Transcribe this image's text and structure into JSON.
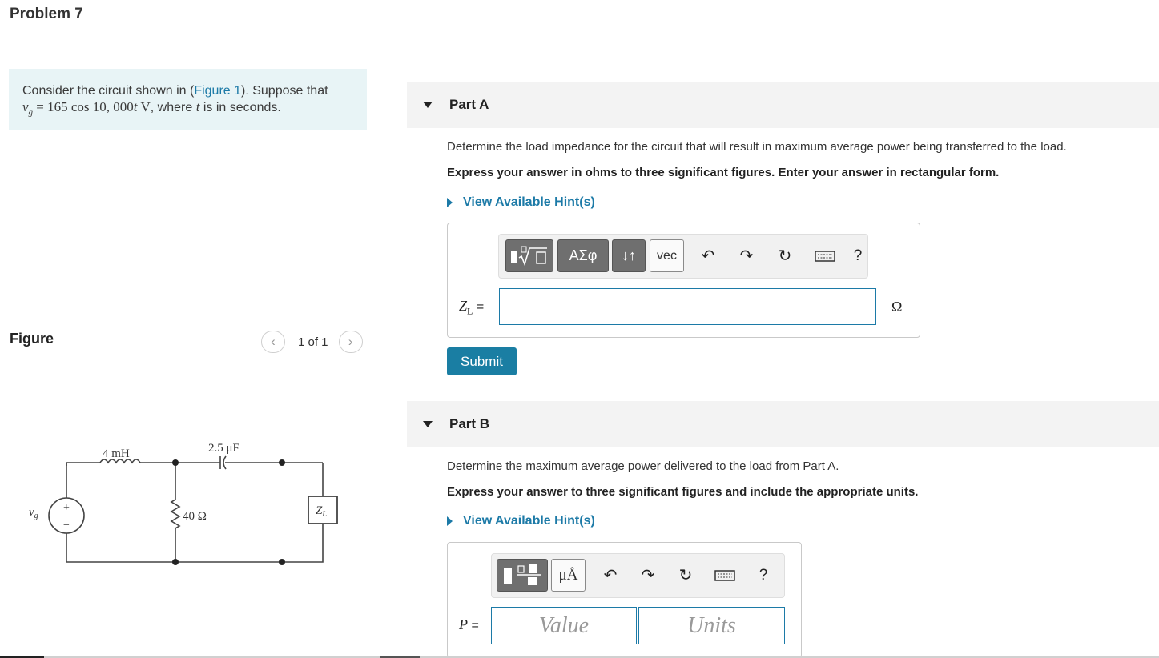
{
  "problem_title": "Problem 7",
  "intro": {
    "text_before": "Consider the circuit shown in (",
    "figure_link": "Figure 1",
    "text_after": "). Suppose that",
    "equation_text": "= 165 cos 10, 000",
    "equation_unit": "V",
    "text_end": ", where",
    "text_final": "is in seconds."
  },
  "figure": {
    "label": "Figure",
    "counter": "1 of 1",
    "prev_icon": "chevron-left",
    "next_icon": "chevron-right",
    "circuit": {
      "inductor": "4 mH",
      "capacitor": "2.5 μF",
      "resistor": "40 Ω",
      "load": "Z",
      "load_sub": "L",
      "source": "v",
      "source_sub": "g",
      "plus": "+",
      "minus": "−"
    }
  },
  "part_a": {
    "title": "Part A",
    "question": "Determine the load impedance for the circuit that will result in maximum average power being transferred to the load.",
    "instruction": "Express your answer in ohms to three significant figures. Enter your answer in rectangular form.",
    "hint": "View Available Hint(s)",
    "toolbar": {
      "templates_icon": "fraction-sqrt-template-icon",
      "greek": "ΑΣφ",
      "arrows": "↓↑",
      "vec": "vec",
      "undo_icon": "undo-icon",
      "redo_icon": "redo-icon",
      "reset_icon": "reset-icon",
      "keyboard_icon": "keyboard-icon",
      "help": "?"
    },
    "input_label": "Z",
    "input_label_sub": "L",
    "input_eq": "=",
    "input_value": "",
    "unit": "Ω",
    "submit": "Submit"
  },
  "part_b": {
    "title": "Part B",
    "question": "Determine the maximum average power delivered to the load from Part A.",
    "instruction": "Express your answer to three significant figures and include the appropriate units.",
    "hint": "View Available Hint(s)",
    "toolbar": {
      "templates_icon": "fraction-template-icon",
      "units": "μÅ",
      "undo_icon": "undo-icon",
      "redo_icon": "redo-icon",
      "reset_icon": "reset-icon",
      "keyboard_icon": "keyboard-icon",
      "help": "?"
    },
    "input_label": "P",
    "input_eq": "=",
    "value_placeholder": "Value",
    "units_placeholder": "Units"
  }
}
